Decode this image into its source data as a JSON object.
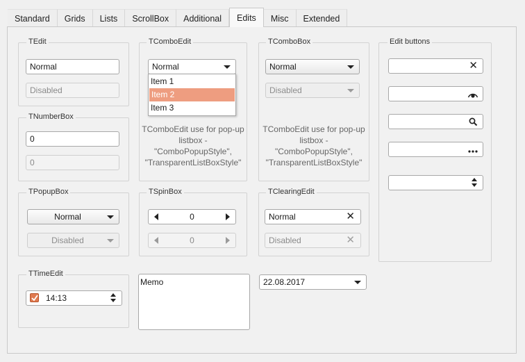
{
  "tabs": [
    "Standard",
    "Grids",
    "Lists",
    "ScrollBox",
    "Additional",
    "Edits",
    "Misc",
    "Extended"
  ],
  "active_tab": "Edits",
  "tedit": {
    "title": "TEdit",
    "normal": "Normal",
    "disabled": "Disabled"
  },
  "tnumberbox": {
    "title": "TNumberBox",
    "value": "0",
    "disabled_value": "0"
  },
  "tpopupbox": {
    "title": "TPopupBox",
    "normal": "Normal",
    "disabled": "Disabled"
  },
  "ttimeedit": {
    "title": "TTimeEdit",
    "value": "14:13",
    "checked": true
  },
  "tcomboedit": {
    "title": "TComboEdit",
    "value": "Normal",
    "items": [
      "Item 1",
      "Item 2",
      "Item 3"
    ],
    "selected_index": 1,
    "note": [
      "TComboEdit use for pop-up",
      "listbox -",
      "\"ComboPopupStyle\",",
      "\"TransparentListBoxStyle\""
    ]
  },
  "tspinbox": {
    "title": "TSpinBox",
    "value": "0",
    "disabled_value": "0"
  },
  "memo": {
    "text": "Memo"
  },
  "tcombobox": {
    "title": "TComboBox",
    "normal": "Normal",
    "disabled": "Disabled",
    "note": [
      "TComboEdit use for pop-up",
      "listbox -",
      "\"ComboPopupStyle\",",
      "\"TransparentListBoxStyle\""
    ]
  },
  "tclearingedit": {
    "title": "TClearingEdit",
    "normal": "Normal",
    "disabled": "Disabled"
  },
  "dateedit": {
    "value": "22.08.2017"
  },
  "edit_buttons": {
    "title": "Edit buttons",
    "icons": [
      "clear-icon",
      "password-eye-icon",
      "search-icon",
      "ellipsis-icon",
      "spin-icon"
    ]
  },
  "colors": {
    "accent": "#ee9d80",
    "check": "#e07a50"
  }
}
